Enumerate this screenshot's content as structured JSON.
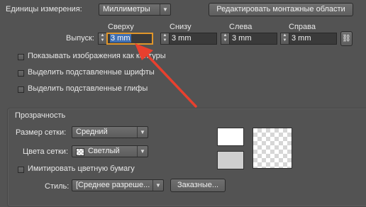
{
  "top": {
    "units_label": "Единицы измерения:",
    "units_value": "Миллиметры",
    "edit_areas_button": "Редактировать монтажные области"
  },
  "bleed": {
    "label": "Выпуск:",
    "columns": [
      {
        "header": "Сверху",
        "value": "3 mm"
      },
      {
        "header": "Снизу",
        "value": "3 mm"
      },
      {
        "header": "Слева",
        "value": "3 mm"
      },
      {
        "header": "Справа",
        "value": "3 mm"
      }
    ]
  },
  "options": {
    "show_images_outline": "Показывать изображения как контуры",
    "highlight_substituted_fonts": "Выделить подставленные шрифты",
    "highlight_substituted_glyphs": "Выделить подставленные глифы"
  },
  "transparency": {
    "title": "Прозрачность",
    "grid_size_label": "Размер сетки:",
    "grid_size_value": "Средний",
    "grid_colors_label": "Цвета сетки:",
    "grid_colors_value": "Светлый",
    "simulate_paper": "Имитировать цветную бумагу",
    "style_label": "Стиль:",
    "style_value": "[Среднее разреше...",
    "custom_button": "Заказные..."
  },
  "colors": {
    "accent": "#e8402e",
    "focus": "#e0962a"
  }
}
